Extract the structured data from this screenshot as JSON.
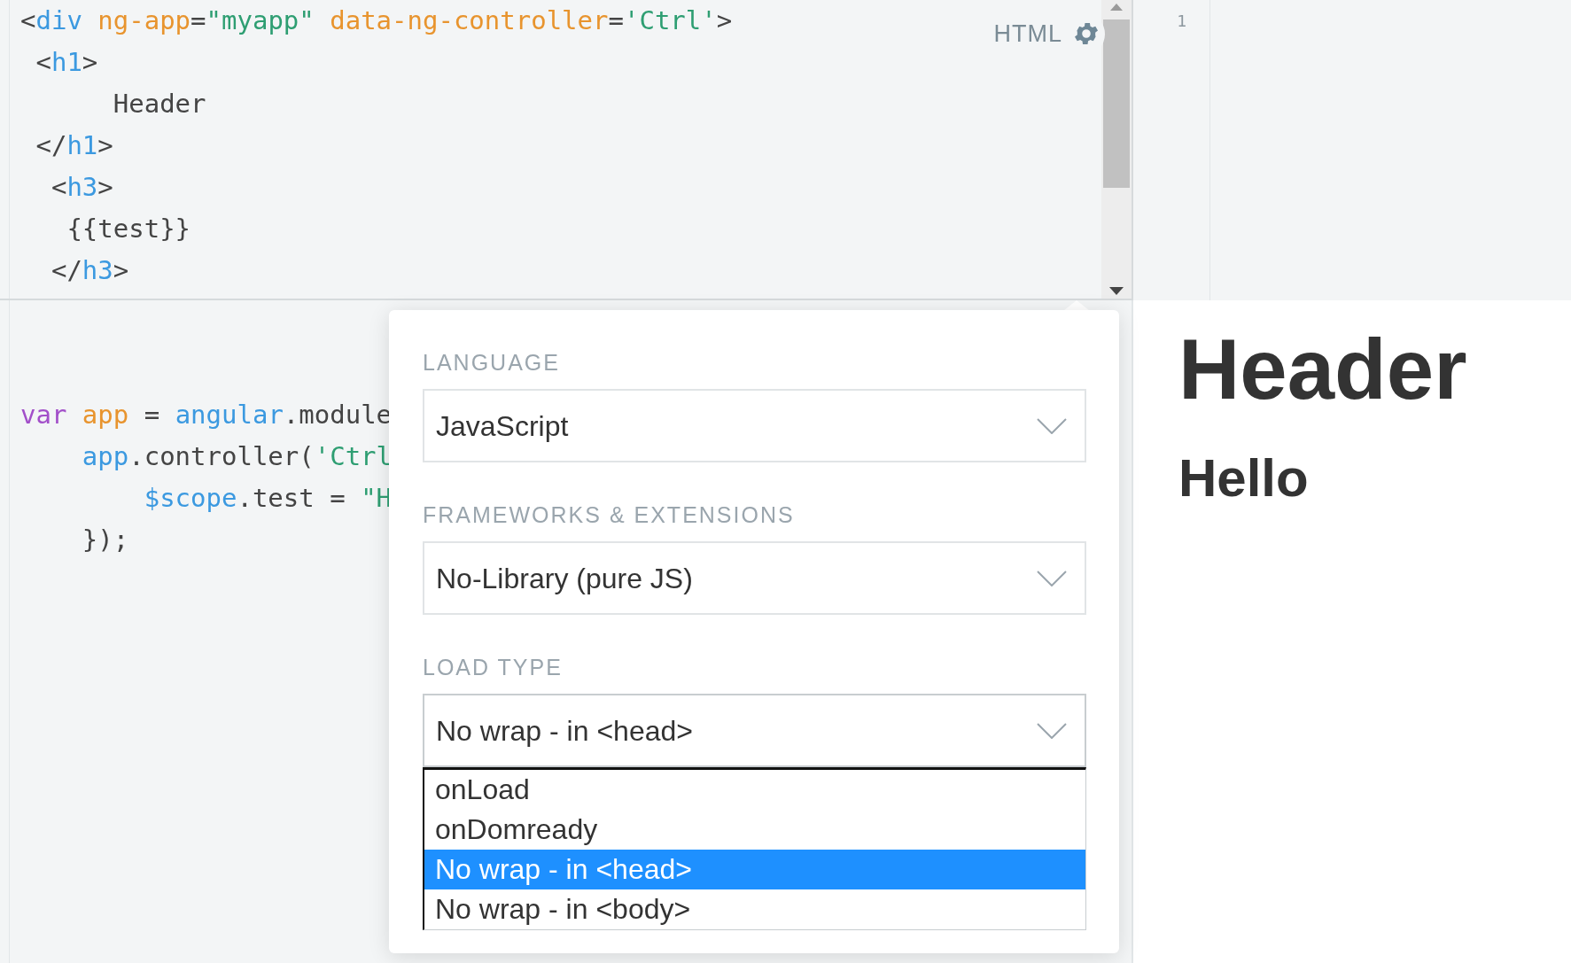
{
  "html_editor": {
    "language_label": "HTML",
    "lines": [
      [
        {
          "kind": "punct",
          "text": "<"
        },
        {
          "kind": "tag",
          "text": "div"
        },
        {
          "kind": "attr",
          "text": " ng-app"
        },
        {
          "kind": "punct",
          "text": "="
        },
        {
          "kind": "string",
          "text": "\"myapp\""
        },
        {
          "kind": "attr",
          "text": " data-ng-controller"
        },
        {
          "kind": "punct",
          "text": "="
        },
        {
          "kind": "string",
          "text": "'Ctrl'"
        },
        {
          "kind": "punct",
          "text": ">"
        }
      ],
      [
        {
          "kind": "punct",
          "text": " <"
        },
        {
          "kind": "tag",
          "text": "h1"
        },
        {
          "kind": "punct",
          "text": ">"
        }
      ],
      [
        {
          "kind": "plain",
          "text": "      Header"
        }
      ],
      [
        {
          "kind": "punct",
          "text": " </"
        },
        {
          "kind": "tag",
          "text": "h1"
        },
        {
          "kind": "punct",
          "text": ">"
        }
      ],
      [
        {
          "kind": "punct",
          "text": "  <"
        },
        {
          "kind": "tag",
          "text": "h3"
        },
        {
          "kind": "punct",
          "text": ">"
        }
      ],
      [
        {
          "kind": "plain",
          "text": "   {{test}}"
        }
      ],
      [
        {
          "kind": "punct",
          "text": "  </"
        },
        {
          "kind": "tag",
          "text": "h3"
        },
        {
          "kind": "punct",
          "text": ">"
        }
      ]
    ]
  },
  "css_editor": {
    "line_numbers": [
      "1"
    ]
  },
  "js_editor": {
    "lines": [
      [
        {
          "kind": "keyword",
          "text": "var"
        },
        {
          "kind": "attr",
          "text": " app"
        },
        {
          "kind": "plain",
          "text": " = "
        },
        {
          "kind": "tag",
          "text": "angular"
        },
        {
          "kind": "plain",
          "text": ".module"
        }
      ],
      [
        {
          "kind": "tag",
          "text": "    app"
        },
        {
          "kind": "plain",
          "text": ".controller("
        },
        {
          "kind": "string",
          "text": "'Ctrl"
        }
      ],
      [
        {
          "kind": "tag",
          "text": "        $scope"
        },
        {
          "kind": "plain",
          "text": ".test = "
        },
        {
          "kind": "string",
          "text": "\"H"
        }
      ],
      [
        {
          "kind": "plain",
          "text": "    });"
        }
      ]
    ]
  },
  "settings_popover": {
    "sections": [
      {
        "label": "LANGUAGE",
        "value": "JavaScript",
        "expanded": false
      },
      {
        "label": "FRAMEWORKS & EXTENSIONS",
        "value": "No-Library (pure JS)",
        "expanded": false
      },
      {
        "label": "LOAD TYPE",
        "value": "No wrap - in <head>",
        "expanded": true,
        "options": [
          {
            "label": "onLoad",
            "selected": false
          },
          {
            "label": "onDomready",
            "selected": false
          },
          {
            "label": "No wrap - in <head>",
            "selected": true
          },
          {
            "label": "No wrap - in <body>",
            "selected": false
          }
        ]
      }
    ]
  },
  "result": {
    "heading": "Header",
    "subheading": "Hello"
  }
}
